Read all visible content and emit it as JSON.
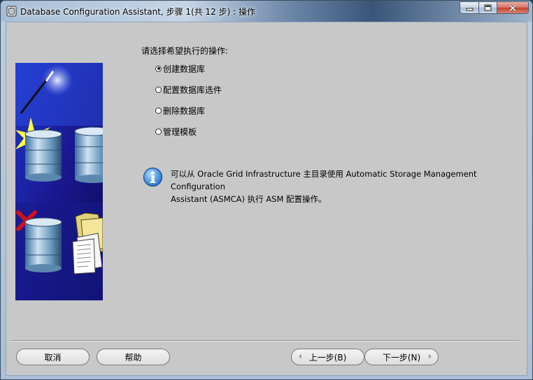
{
  "window": {
    "title": "Database Configuration Assistant, 步骤 1(共 12 步) : 操作"
  },
  "main": {
    "prompt": "请选择希望执行的操作:",
    "options": [
      {
        "label": "创建数据库",
        "selected": true
      },
      {
        "label": "配置数据库选件",
        "selected": false
      },
      {
        "label": "删除数据库",
        "selected": false
      },
      {
        "label": "管理模板",
        "selected": false
      }
    ],
    "info": {
      "line1": "可以从 Oracle Grid Infrastructure 主目录使用 Automatic Storage Management Configuration",
      "line2": "Assistant (ASMCA) 执行 ASM 配置操作。"
    }
  },
  "buttons": {
    "cancel": "取消",
    "help": "帮助",
    "back": "上一步(B)",
    "next": "下一步(N)"
  },
  "colors": {
    "panel_bg": "#c8c8c8",
    "art_blue": "#1a1aa0",
    "check_red": "#d0101a"
  },
  "icons": [
    "app-icon",
    "minimize-icon",
    "maximize-icon",
    "close-icon",
    "info-icon",
    "chevron-left-icon",
    "chevron-right-icon"
  ]
}
